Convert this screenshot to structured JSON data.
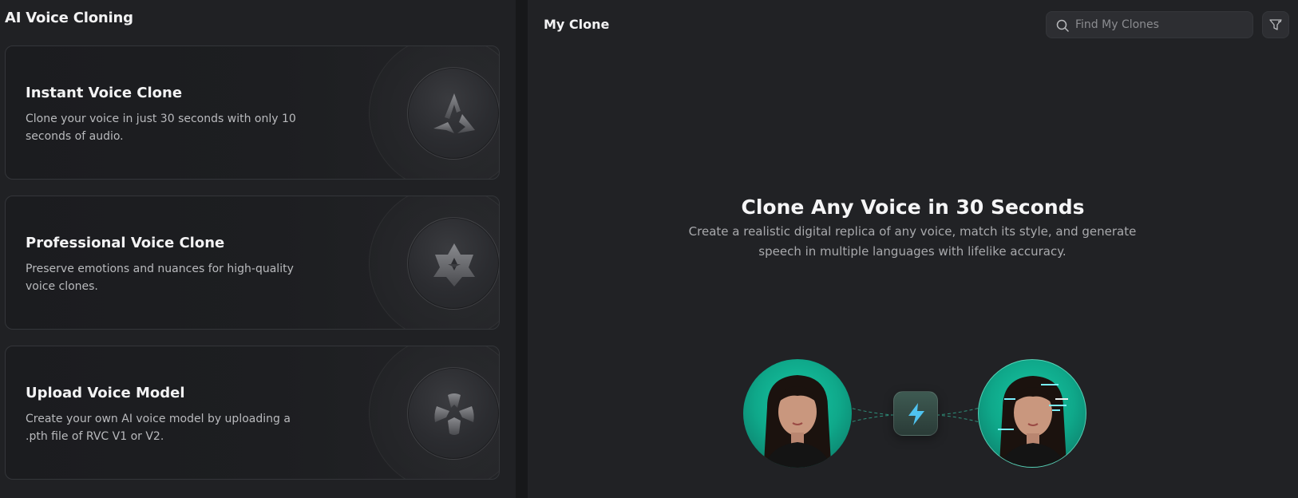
{
  "left_panel": {
    "title": "AI Voice Cloning",
    "cards": [
      {
        "title": "Instant Voice Clone",
        "description": "Clone your voice in just 30 seconds with only 10 seconds of audio.",
        "icon": "triangle-logo-icon"
      },
      {
        "title": "Professional Voice Clone",
        "description": "Preserve emotions and nuances for high-quality voice clones.",
        "icon": "star-gem-icon"
      },
      {
        "title": "Upload Voice Model",
        "description": "Create your own AI voice model by uploading a .pth file of RVC V1 or V2.",
        "icon": "upload-model-icon"
      }
    ]
  },
  "right_panel": {
    "title": "My Clone",
    "search": {
      "placeholder": "Find My Clones",
      "value": "",
      "icon": "search-icon"
    },
    "filter": {
      "icon": "filter-icon"
    },
    "hero": {
      "title": "Clone Any Voice in 30 Seconds",
      "description": "Create a realistic digital replica of any voice, match its style, and generate speech in multiple languages with lifelike accuracy."
    },
    "illustration": {
      "left": "portrait-original",
      "center_icon": "lightning-bolt-icon",
      "right": "portrait-cloned"
    }
  },
  "colors": {
    "panel_bg": "#202124",
    "right_bg": "#212225",
    "accent_teal": "#13b896",
    "bolt_blue": "#4fc3f0"
  }
}
